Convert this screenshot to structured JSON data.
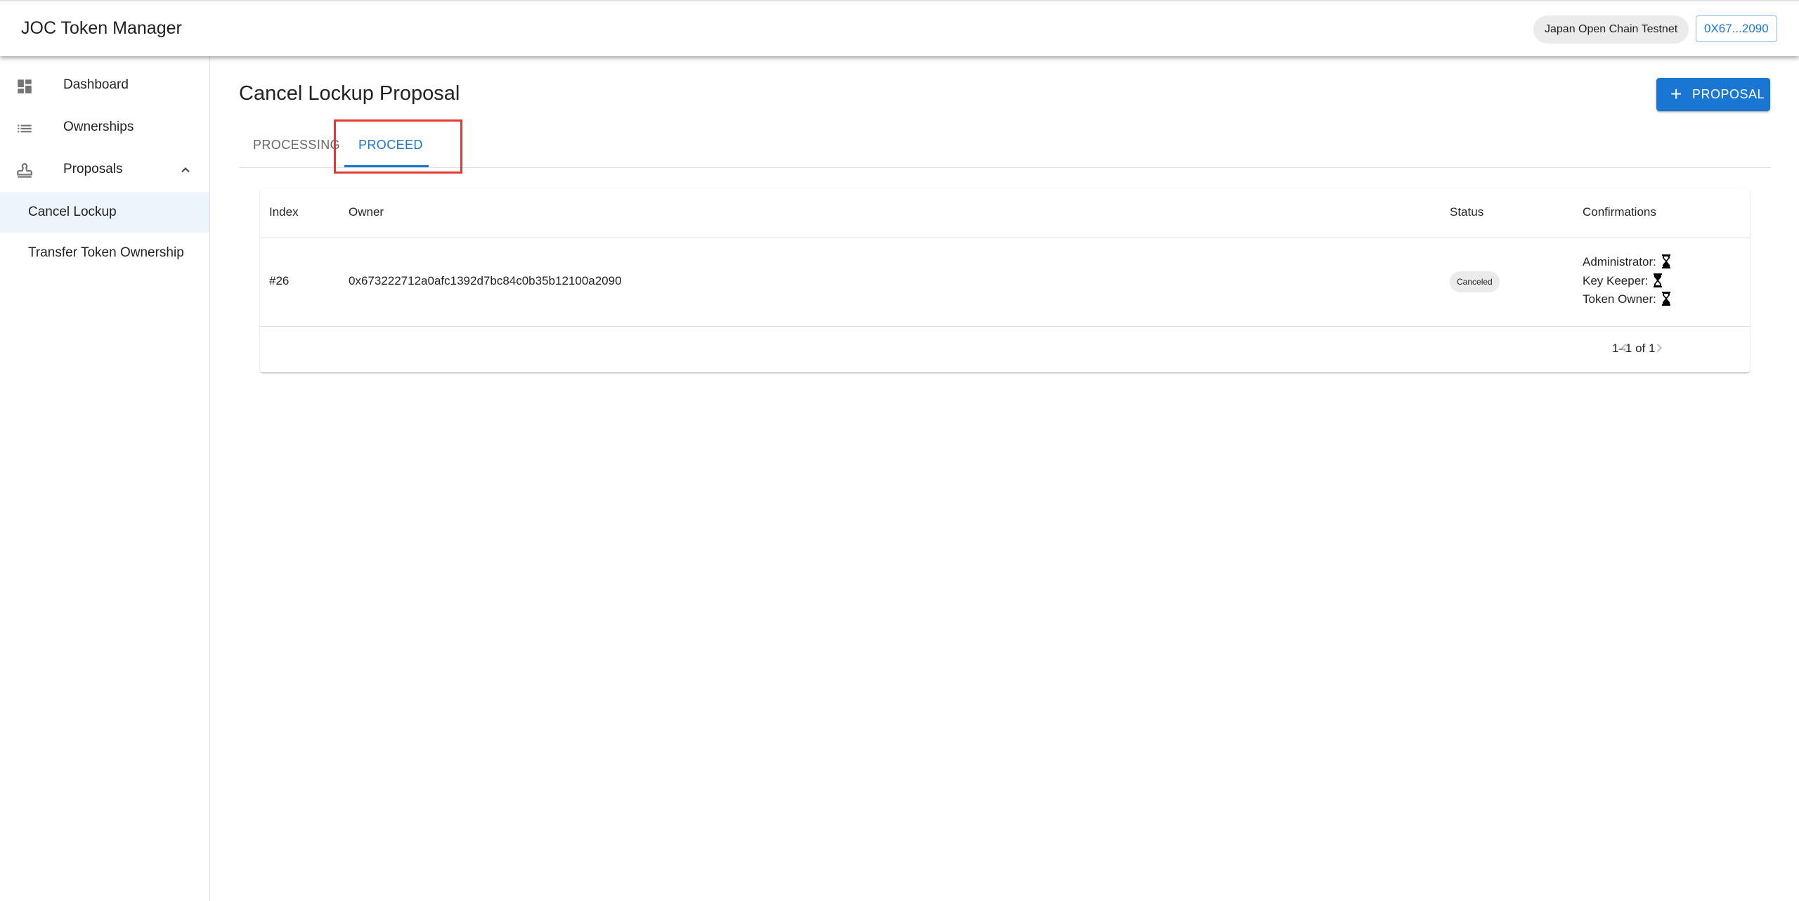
{
  "app": {
    "title": "JOC Token Manager"
  },
  "header": {
    "chain_label": "Japan Open Chain Testnet",
    "wallet_label": "0X67...2090"
  },
  "sidebar": {
    "items": [
      {
        "label": "Dashboard",
        "icon": "dashboard-icon"
      },
      {
        "label": "Ownerships",
        "icon": "list-icon"
      },
      {
        "label": "Proposals",
        "icon": "stamp-icon",
        "expanded": true
      }
    ],
    "sub_items": [
      {
        "label": "Cancel Lockup",
        "selected": true
      },
      {
        "label": "Transfer Token Ownership",
        "selected": false
      }
    ]
  },
  "main": {
    "title": "Cancel Lockup Proposal",
    "add_button_label": "PROPOSAL",
    "tabs": [
      {
        "label": "PROCESSING",
        "active": false
      },
      {
        "label": "PROCEED",
        "active": true
      }
    ],
    "table": {
      "headers": {
        "index": "Index",
        "owner": "Owner",
        "status": "Status",
        "confirmations": "Confirmations"
      },
      "rows": [
        {
          "index": "#26",
          "owner": "0x673222712a0afc1392d7bc84c0b35b12100a2090",
          "status": "Canceled",
          "confirmations": [
            {
              "label": "Administrator:",
              "icon": "hourglass-icon"
            },
            {
              "label": "Key Keeper:",
              "icon": "hourglass-icon"
            },
            {
              "label": "Token Owner:",
              "icon": "hourglass-icon"
            }
          ]
        }
      ],
      "pagination": "1–1 of 1"
    }
  },
  "colors": {
    "primary": "#1976d2",
    "highlight": "#e53935",
    "selected_bg": "#edf3fb",
    "chip_bg": "#ebebeb"
  }
}
